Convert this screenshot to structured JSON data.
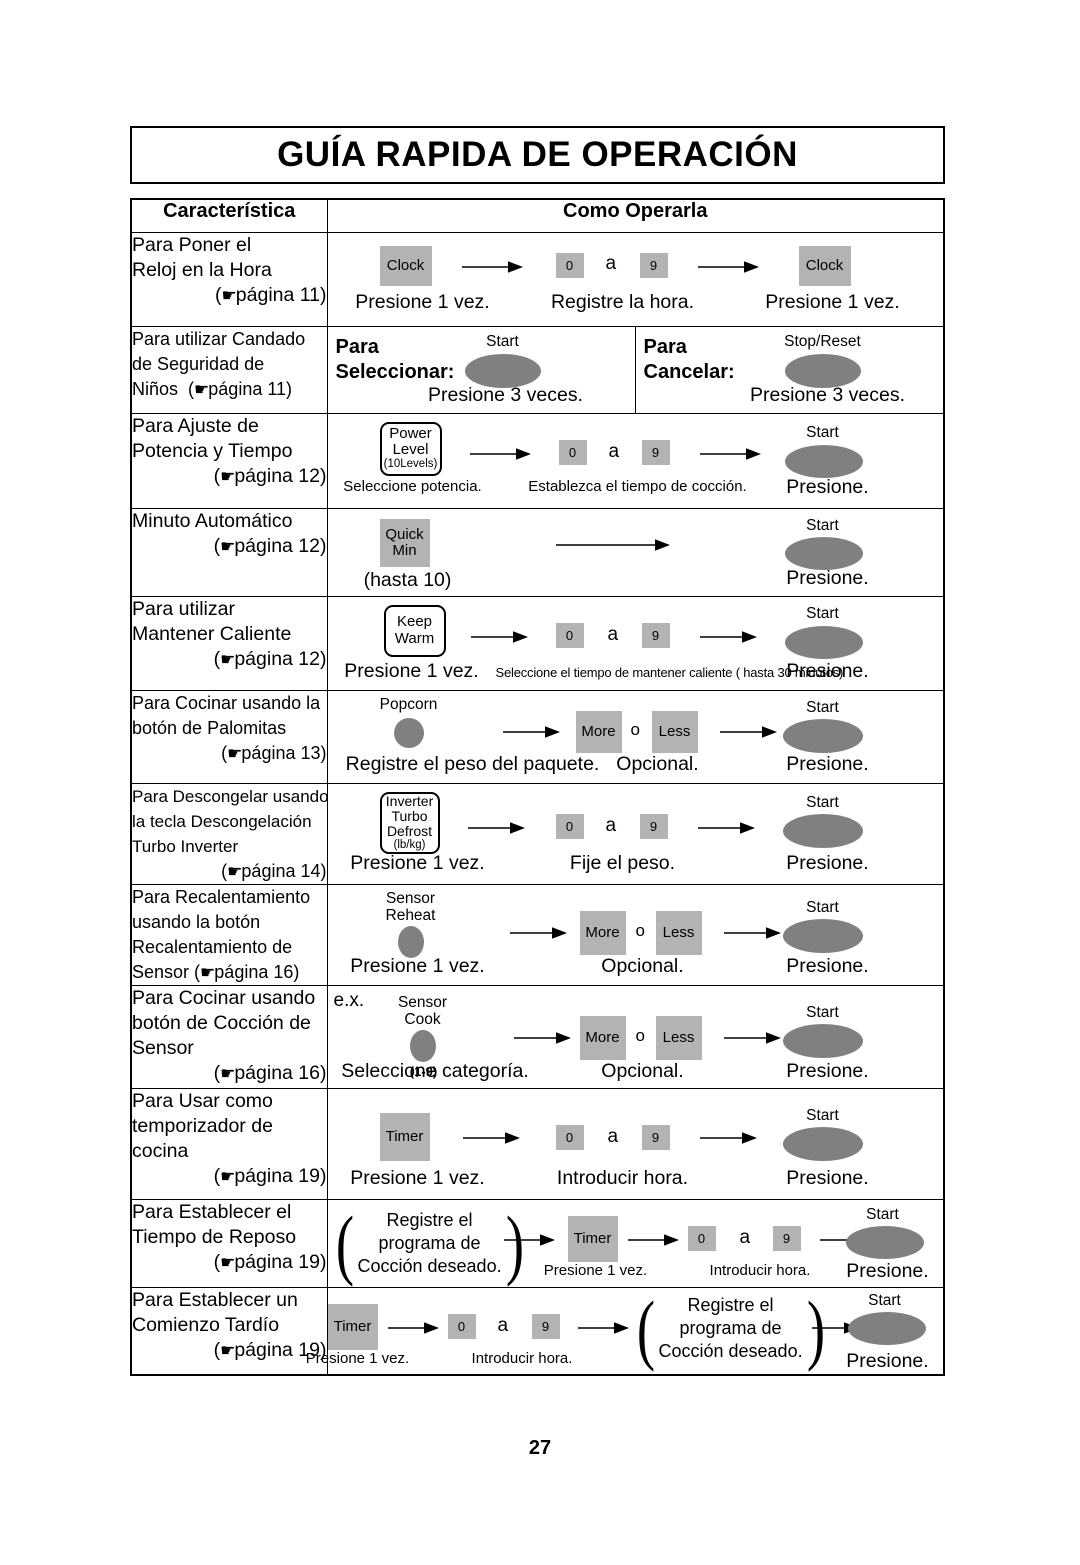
{
  "document": {
    "title": "GUÍA RAPIDA DE OPERACIÓN",
    "page_number": "27"
  },
  "table": {
    "headers": {
      "feature": "Característica",
      "operation": "Como Operarla"
    },
    "rows": [
      {
        "id": "set-clock",
        "feature_lines": [
          "Para Poner el",
          "Reloj en la Hora"
        ],
        "page_ref": "página 11",
        "steps": [
          {
            "key": "Clock",
            "caption": "Presione 1 vez."
          },
          {
            "key_range": [
              "0",
              "9"
            ],
            "joiner": "a",
            "caption": "Registre la hora."
          },
          {
            "key": "Clock",
            "caption": "Presione 1 vez."
          }
        ]
      },
      {
        "id": "child-lock",
        "feature_lines": [
          "Para utilizar Candado",
          "de Seguridad de",
          "Niños"
        ],
        "page_ref": "página 11",
        "split": true,
        "left": {
          "lead": [
            "Para",
            "Seleccionar:"
          ],
          "key": "Start",
          "caption": "Presione 3 veces."
        },
        "right": {
          "lead": [
            "Para",
            "Cancelar:"
          ],
          "key": "Stop/Reset",
          "caption": "Presione 3 veces."
        }
      },
      {
        "id": "power-time",
        "feature_lines": [
          "Para Ajuste de",
          "Potencia y Tiempo"
        ],
        "page_ref": "página 12",
        "steps": [
          {
            "key_lines": [
              "Power",
              "Level"
            ],
            "key_sub": "(10Levels)",
            "caption": "Seleccione potencia."
          },
          {
            "key_range": [
              "0",
              "9"
            ],
            "joiner": "a",
            "caption": "Establezca el tiempo de cocción."
          },
          {
            "key": "Start",
            "caption": "Presione."
          }
        ]
      },
      {
        "id": "quick-min",
        "feature_lines": [
          "Minuto Automático"
        ],
        "page_ref": "página 12",
        "steps": [
          {
            "key_lines": [
              "Quick",
              "Min"
            ],
            "caption": "(hasta 10)"
          },
          {
            "key": "Start",
            "caption": "Presione."
          }
        ]
      },
      {
        "id": "keep-warm",
        "feature_lines": [
          "Para utilizar",
          "Mantener Caliente"
        ],
        "page_ref": "página 12",
        "steps": [
          {
            "key_lines": [
              "Keep",
              "Warm"
            ],
            "caption": "Presione 1 vez."
          },
          {
            "key_range": [
              "0",
              "9"
            ],
            "joiner": "a",
            "caption": "Seleccione el tiempo de mantener caliente ( hasta 30 minutos)"
          },
          {
            "key": "Start",
            "caption": "Presione."
          }
        ]
      },
      {
        "id": "popcorn",
        "feature_lines": [
          "Para Cocinar usando la",
          "botón de Palomitas"
        ],
        "page_ref": "página 13",
        "steps": [
          {
            "key": "Popcorn",
            "caption": "Registre el peso del paquete."
          },
          {
            "key_more": "More",
            "joiner": "o",
            "key_less": "Less",
            "caption": "Opcional."
          },
          {
            "key": "Start",
            "caption": "Presione."
          }
        ]
      },
      {
        "id": "turbo-defrost",
        "feature_lines": [
          "Para Descongelar usando",
          "la tecla Descongelación",
          "Turbo Inverter"
        ],
        "page_ref": "página 14",
        "steps": [
          {
            "key_lines": [
              "Inverter",
              "Turbo",
              "Defrost"
            ],
            "key_sub": "(lb/kg)",
            "caption": "Presione 1 vez."
          },
          {
            "key_range": [
              "0",
              "9"
            ],
            "joiner": "a",
            "caption": "Fije el peso."
          },
          {
            "key": "Start",
            "caption": "Presione."
          }
        ]
      },
      {
        "id": "sensor-reheat",
        "feature_lines": [
          "Para Recalentamiento",
          "usando la botón",
          "Recalentamiento de",
          "Sensor"
        ],
        "page_ref": "página 16",
        "steps": [
          {
            "key_lines": [
              "Sensor",
              "Reheat"
            ],
            "caption": "Presione 1 vez."
          },
          {
            "key_more": "More",
            "joiner": "o",
            "key_less": "Less",
            "caption": "Opcional."
          },
          {
            "key": "Start",
            "caption": "Presione."
          }
        ]
      },
      {
        "id": "sensor-cook",
        "feature_lines": [
          "Para Cocinar usando",
          "botón de Cocción de",
          "Sensor"
        ],
        "page_ref": "página 16",
        "prefix": "e.x.",
        "steps": [
          {
            "key_lines": [
              "Sensor",
              "Cook"
            ],
            "key_sub": "(1-9)",
            "caption": "Seleccione categoría."
          },
          {
            "key_more": "More",
            "joiner": "o",
            "key_less": "Less",
            "caption": "Opcional."
          },
          {
            "key": "Start",
            "caption": "Presione."
          }
        ]
      },
      {
        "id": "kitchen-timer",
        "feature_lines": [
          "Para Usar como",
          "temporizador de",
          "cocina"
        ],
        "page_ref": "página 19",
        "steps": [
          {
            "key": "Timer",
            "caption": "Presione 1 vez."
          },
          {
            "key_range": [
              "0",
              "9"
            ],
            "joiner": "a",
            "caption": "Introducir hora."
          },
          {
            "key": "Start",
            "caption": "Presione."
          }
        ]
      },
      {
        "id": "standing-time",
        "feature_lines": [
          "Para Establecer el",
          "Tiempo de Reposo"
        ],
        "page_ref": "página 19",
        "note_lines": [
          "Registre el",
          "programa de",
          "Cocción deseado."
        ],
        "steps": [
          {
            "key": "Timer",
            "caption": "Presione 1 vez."
          },
          {
            "key_range": [
              "0",
              "9"
            ],
            "joiner": "a",
            "caption": "Introducir hora."
          },
          {
            "key": "Start",
            "caption": "Presione."
          }
        ]
      },
      {
        "id": "delay-start",
        "feature_lines": [
          "Para Establecer un",
          "Comienzo Tardío"
        ],
        "page_ref": "página 19",
        "note_lines": [
          "Registre el",
          "programa de",
          "Cocción deseado."
        ],
        "steps": [
          {
            "key": "Timer",
            "caption": "Presione 1 vez."
          },
          {
            "key_range": [
              "0",
              "9"
            ],
            "joiner": "a",
            "caption": "Introducir hora."
          },
          {
            "key": "Start",
            "caption": "Presione."
          }
        ]
      }
    ]
  },
  "colors": {
    "key_gray": "#b3b3b3",
    "button_gray": "#808080",
    "border": "#000000"
  }
}
